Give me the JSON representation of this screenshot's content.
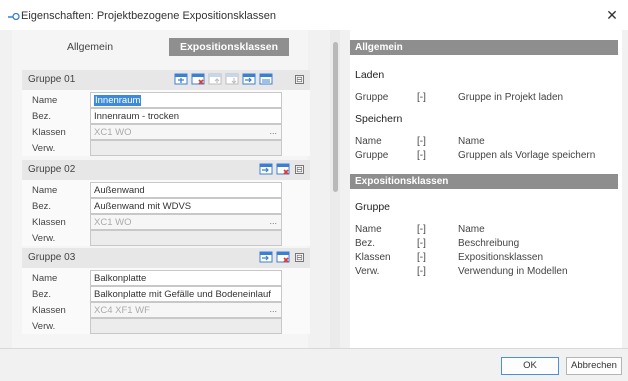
{
  "window": {
    "title": "Eigenschaften: Projektbezogene Expositionsklassen"
  },
  "tabs": {
    "general": "Allgemein",
    "exposure": "Expositionsklassen"
  },
  "row_labels": {
    "name": "Name",
    "bez": "Bez.",
    "klassen": "Klassen",
    "verw": "Verw."
  },
  "groups": [
    {
      "name": "Gruppe 01",
      "fields": {
        "name": "Innenraum",
        "bez": "Innenraum - trocken",
        "klassen": "XC1 WO",
        "verw": ""
      }
    },
    {
      "name": "Gruppe 02",
      "fields": {
        "name": "Außenwand",
        "bez": "Außenwand mit WDVS",
        "klassen": "XC1 WO",
        "verw": ""
      }
    },
    {
      "name": "Gruppe 03",
      "fields": {
        "name": "Balkonplatte",
        "bez": "Balkonplatte mit Gefälle und Bodeneinlauf",
        "klassen": "XC4 XF1 WF",
        "verw": ""
      }
    }
  ],
  "ellipsis": "...",
  "collapse_glyph": "⊟",
  "help": {
    "sections": [
      {
        "title": "Allgemein"
      },
      {
        "title": "Expositionsklassen"
      }
    ],
    "laden": {
      "heading": "Laden",
      "rows": [
        {
          "c1": "Gruppe",
          "c2": "[-]",
          "c3": "Gruppe in Projekt laden"
        }
      ]
    },
    "speichern": {
      "heading": "Speichern",
      "rows": [
        {
          "c1": "Name",
          "c2": "[-]",
          "c3": "Name"
        },
        {
          "c1": "Gruppe",
          "c2": "[-]",
          "c3": "Gruppen als Vorlage speichern"
        }
      ]
    },
    "gruppe": {
      "heading": "Gruppe",
      "rows": [
        {
          "c1": "Name",
          "c2": "[-]",
          "c3": "Name"
        },
        {
          "c1": "Bez.",
          "c2": "[-]",
          "c3": "Beschreibung"
        },
        {
          "c1": "Klassen",
          "c2": "[-]",
          "c3": "Expositionsklassen"
        },
        {
          "c1": "Verw.",
          "c2": "[-]",
          "c3": "Verwendung in Modellen"
        }
      ]
    }
  },
  "buttons": {
    "ok": "OK",
    "cancel": "Abbrechen"
  },
  "colors": {
    "accent": "#3d8ad9",
    "section_bar": "#8e8e8e",
    "icon_blue": "#3b7fd0",
    "icon_red": "#d23c3c"
  }
}
